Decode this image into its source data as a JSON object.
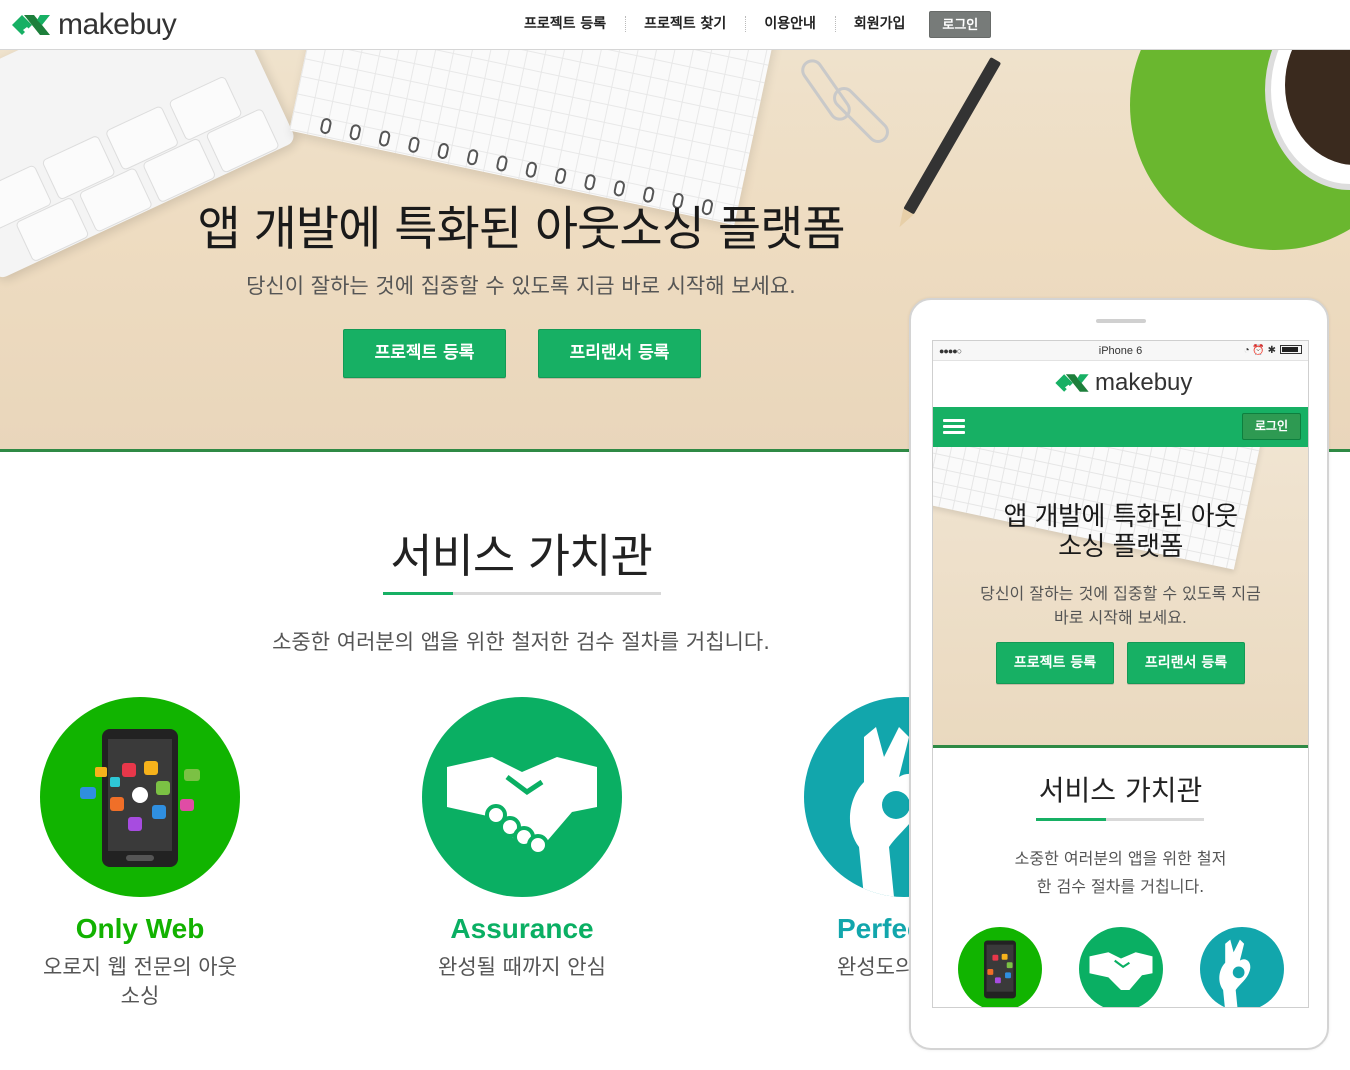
{
  "brand": {
    "name": "makebuy",
    "accent": "#17b064",
    "logo_icon": "makebuy-logo-icon"
  },
  "header": {
    "nav": [
      "프로젝트 등록",
      "프로젝트 찾기",
      "이용안내",
      "회원가입"
    ],
    "login_label": "로그인"
  },
  "hero": {
    "title": "앱 개발에 특화된 아웃소싱 플랫폼",
    "subtitle": "당신이 잘하는 것에 집중할 수 있도록 지금 바로 시작해 보세요.",
    "buttons": [
      "프로젝트 등록",
      "프리랜서 등록"
    ]
  },
  "service": {
    "title": "서비스 가치관",
    "subtitle": "소중한 여러분의 앱을 위한 철저한 검수 절차를 거칩니다.",
    "features": [
      {
        "title": "Only Web",
        "desc": "오로지 웹 전문의 아웃소싱",
        "icon": "smartphone-apps-icon",
        "color": "#11b400"
      },
      {
        "title": "Assurance",
        "desc": "완성될 때까지 안심",
        "icon": "handshake-icon",
        "color": "#0aaf63"
      },
      {
        "title": "Perfect",
        "desc": "완성도의",
        "icon": "ok-hand-icon",
        "color": "#12a6ac"
      }
    ]
  },
  "phone": {
    "status_dots": "●●●●○",
    "device_name": "iPhone 6",
    "status_icons": "◔ ⏰ ✱",
    "login_label": "로그인",
    "hero_title": "앱 개발에 특화된 아웃소싱 플랫폼",
    "hero_subtitle": "당신이 잘하는 것에 집중할 수 있도록 지금 바로 시작해 보세요.",
    "buttons": [
      "프로젝트 등록",
      "프리랜서 등록"
    ],
    "service_title": "서비스 가치관",
    "service_subtitle": "소중한 여러분의 앱을 위한 철저한 검수 절차를 거칩니다."
  }
}
